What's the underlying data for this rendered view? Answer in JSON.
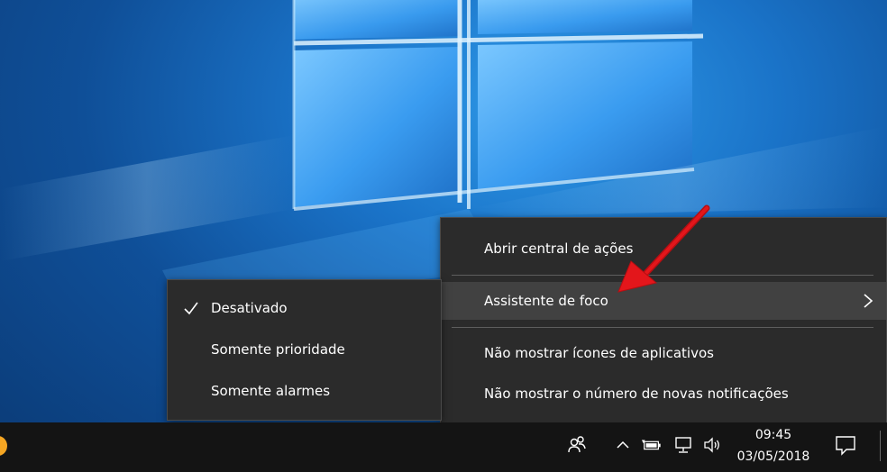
{
  "context_menu": {
    "items": [
      {
        "label": "Abrir central de ações"
      },
      {
        "label": "Assistente de foco"
      },
      {
        "label": "Não mostrar ícones de aplicativos"
      },
      {
        "label": "Não mostrar o número de novas notificações"
      }
    ]
  },
  "focus_submenu": {
    "items": [
      {
        "label": "Desativado",
        "checked": true
      },
      {
        "label": "Somente prioridade",
        "checked": false
      },
      {
        "label": "Somente alarmes",
        "checked": false
      }
    ]
  },
  "taskbar": {
    "clock": {
      "time": "09:45",
      "date": "03/05/2018"
    },
    "tray_icons": [
      "people-icon",
      "chevron-up-icon",
      "battery-icon",
      "network-icon",
      "volume-icon",
      "notification-icon"
    ]
  },
  "colors": {
    "menu_bg": "#2b2b2b",
    "menu_hover": "#414141",
    "taskbar_bg": "#141414",
    "annotation_arrow": "#e3161b"
  }
}
